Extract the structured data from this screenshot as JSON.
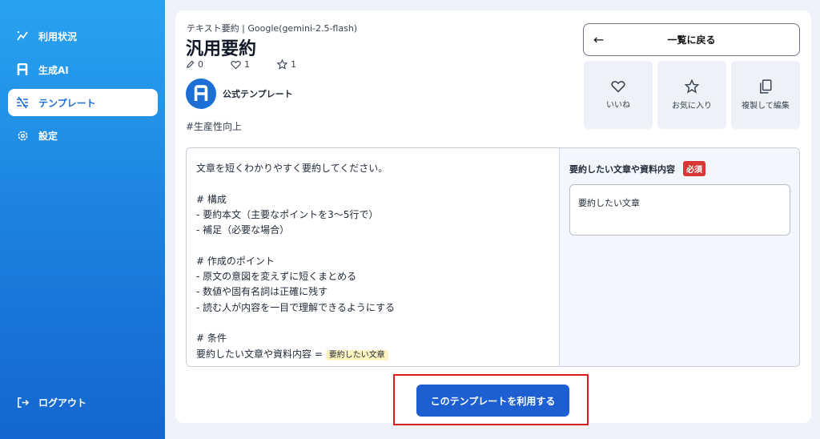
{
  "sidebar": {
    "items": [
      {
        "label": "利用状況",
        "icon": "usage-chart-icon"
      },
      {
        "label": "生成AI",
        "icon": "ai-logo-icon"
      },
      {
        "label": "テンプレート",
        "icon": "template-grid-icon",
        "active": true
      },
      {
        "label": "設定",
        "icon": "gear-icon"
      }
    ],
    "logout": {
      "label": "ログアウト",
      "icon": "logout-icon"
    }
  },
  "template": {
    "breadcrumb": "テキスト要約 | Google(gemini-2.5-flash)",
    "title": "汎用要約",
    "stats": {
      "edits": "0",
      "likes": "1",
      "favorites": "1"
    },
    "author": "公式テンプレート",
    "tag": "#生産性向上"
  },
  "actions": {
    "back": "一覧に戻る",
    "like": "いいね",
    "favorite": "お気に入り",
    "duplicate": "複製して編集"
  },
  "prompt": {
    "lines": [
      "文章を短くわかりやすく要約してください。",
      "",
      "# 構成",
      "- 要約本文（主要なポイントを3〜5行で）",
      "- 補足（必要な場合）",
      "",
      "# 作成のポイント",
      "- 原文の意図を変えずに短くまとめる",
      "- 数値や固有名詞は正確に残す",
      "- 読む人が内容を一目で理解できるようにする",
      "",
      "# 条件"
    ],
    "last_line_prefix": "要約したい文章や資料内容 = ",
    "variable_chip": "要約したい文章"
  },
  "input_panel": {
    "label": "要約したい文章や資料内容",
    "required_badge": "必須",
    "placeholder": "要約したい文章"
  },
  "use_button": "このテンプレートを利用する",
  "colors": {
    "accent": "#1d5fd1",
    "required": "#d93636",
    "highlight_box": "#d81e1e"
  }
}
